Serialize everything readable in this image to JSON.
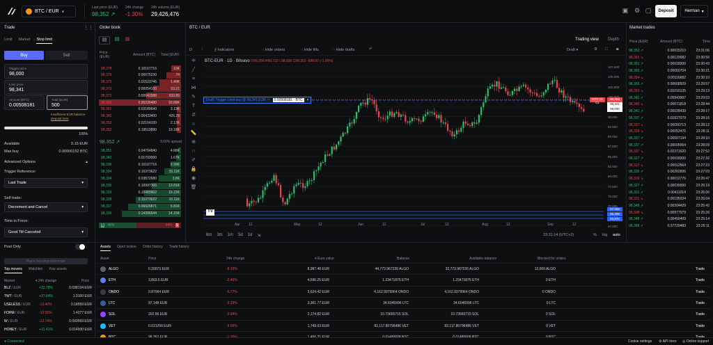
{
  "header": {
    "pair": "BTC / EUR",
    "last_price_label": "Last price (EUR)",
    "last_price": "98,352",
    "change_label": "24h change",
    "change": "-1.30%",
    "volume_label": "24h volume (EUR)",
    "volume": "29,426,476",
    "deposit": "Deposit",
    "user": "Herman"
  },
  "trade": {
    "title": "Trade",
    "tabs": [
      "Limit",
      "Market",
      "Stop limit"
    ],
    "buy": "Buy",
    "sell": "Sell",
    "trigger_label": "Trigger price",
    "trigger_value": "98,000",
    "limit_label": "Limit price",
    "limit_value": "98,341",
    "amount_label": "Amount (BTC)",
    "amount_value": "0.00508181",
    "total_label": "Total (EUR)",
    "total_value": "500",
    "warning": "Insufficient EUR balance.",
    "warning_link": "Deposit here",
    "slider_pct": "100%",
    "available_label": "Available",
    "available_value": "0.15 EUR",
    "maxbuy_label": "Max buy",
    "maxbuy_value": "0.00000152 BTC",
    "advanced": "Advanced Options",
    "trigger_ref_label": "Trigger Reference:",
    "trigger_ref": "Last Trade",
    "self_trade_label": "Self trade:",
    "self_trade": "Decrement and Cancel",
    "tif_label": "Time in Force:",
    "tif": "Good Till Canceled",
    "post_only": "Post Only",
    "submit": "Place buy stop limit order"
  },
  "movers": {
    "tabs": [
      "Top movers",
      "Watchlist",
      "Your assets"
    ],
    "col_market": "Market",
    "col_change": "24h change",
    "col_price": "Price",
    "rows": [
      {
        "m": "BLZ",
        "q": "/ EUR",
        "c": "+32.78%",
        "p": "0.038134 EUR",
        "up": true
      },
      {
        "m": "TWT",
        "q": "/ EUR",
        "c": "+27.64%",
        "p": "1.0100 EUR",
        "up": true
      },
      {
        "m": "USELESS",
        "q": "/ EUR",
        "c": "-13.40%",
        "p": "0.18559 EUR",
        "up": false
      },
      {
        "m": "FORM",
        "q": "/ EUR",
        "c": "-12.95%",
        "p": "1.4377 EUR",
        "up": false
      },
      {
        "m": "W",
        "q": "/ EUR",
        "c": "-12.74%",
        "p": "0.093569 EUR",
        "up": false
      },
      {
        "m": "HONEY",
        "q": "/ EUR",
        "c": "+12.41%",
        "p": "0.014500 EUR",
        "up": true
      }
    ]
  },
  "orderbook": {
    "title": "Order book",
    "col_price": "Price (EUR)",
    "col_amount": "Amount (BTC)",
    "col_total": "Total (EUR)",
    "spread_price": "98,352",
    "spread_label": "0.00% spread",
    "asks": [
      [
        "98,378",
        "0.10167716",
        "10K",
        0.12
      ],
      [
        "98,376",
        "0.00075230",
        "74",
        0.18
      ],
      [
        "98,375",
        "0.01523746",
        "1.49K",
        0.26
      ],
      [
        "98,373",
        "0.00054100",
        "53.21",
        0.34
      ],
      [
        "98,372",
        "0.00643388",
        "633.89",
        0.42
      ],
      [
        "98,369",
        "0.95239480",
        "93.68K",
        1.0
      ],
      [
        "98,361",
        "0.03189640",
        "3.13K",
        0.05
      ],
      [
        "98,360",
        "0.00433400",
        "426.29",
        0.05
      ],
      [
        "98,353",
        "0.02164100",
        "2.13K",
        0.05
      ],
      [
        "98,352",
        "0.19510890",
        "19.18K",
        0.05
      ]
    ],
    "bids": [
      [
        "98,351",
        "0.04764840",
        "4.68K",
        0.03
      ],
      [
        "98,342",
        "0.01700000",
        "1.67K",
        0.06
      ],
      [
        "98,336",
        "0.10167716",
        "9.99K",
        0.13
      ],
      [
        "98,334",
        "0.15373622",
        "15.11K",
        0.2
      ],
      [
        "98,334",
        "0.03872680",
        "3.8K",
        0.27
      ],
      [
        "98,330",
        "0.10997366",
        "10.81K",
        0.36
      ],
      [
        "98,329",
        "0.15483902",
        "15.22K",
        0.45
      ],
      [
        "98,328",
        "0.15373622",
        "15.11K",
        0.55
      ],
      [
        "98,327",
        "0.06926871",
        "6.81K",
        0.64
      ],
      [
        "98,326",
        "0.14396544",
        "14.15K",
        0.72
      ]
    ],
    "ratio_b": "B",
    "ratio_b_pct": "46%",
    "ratio_s_pct": "54%",
    "ratio_s": "S"
  },
  "chart": {
    "tab": "BTC / EUR",
    "trading_view": "Trading view",
    "depth": "Depth",
    "interval": "D",
    "indicators": "Indicators",
    "hide_orders": "Hide orders",
    "hide_fills": "Hide fills",
    "hide_drafts": "Hide drafts",
    "draft": "Draft",
    "save": "Save",
    "legend": "BTC-EUR · 1D · Bitvavo",
    "ohlc": "O99,356 H99,732 L98,036 C98,352 -998.00 (-1.00%)",
    "draft_order": "Draft: Trigger Limit buy @ 98,341 EUR ->",
    "draft_amt": "0.00508181 · BTC",
    "price_ticks": [
      "107,500",
      "105,000",
      "102,500",
      "100,000",
      "97,500",
      "95,000",
      "92,500",
      "90,000",
      "87,500",
      "85,000",
      "82,500",
      "80,000",
      "77,500",
      "75,000",
      "72,500",
      "70,000",
      "67,500"
    ],
    "tag_trig": "98,352",
    "tag_last": "98,341",
    "tag_set": "98,000",
    "tag_l1": "67,069",
    "tag_l2": "66,395",
    "tag_l3": "63,970",
    "tag_red": "OTC 11 G1",
    "months": [
      "Apr",
      "12",
      "May",
      "12",
      "Jun",
      "12",
      "Jul",
      "12",
      "Aug",
      "12",
      "Sep",
      "12"
    ],
    "ranges": [
      "6m",
      "3m",
      "1m",
      "5d",
      "1d"
    ],
    "clock": "23:31:14 (UTC+2)",
    "pct": "%",
    "log": "log",
    "auto": "auto"
  },
  "market_trades": {
    "title": "Market trades",
    "col_price": "Price (EUR)",
    "col_amount": "Amount (BTC)",
    "col_time": "Time",
    "rows": [
      [
        "98,352",
        "0.00015210",
        "23:31:06",
        1
      ],
      [
        "98,351",
        "0.00120082",
        "23:30:56",
        0
      ],
      [
        "98,351",
        "0.00018300",
        "23:30:43",
        1
      ],
      [
        "98,355",
        "0.00050704",
        "23:30:21",
        1
      ],
      [
        "98,354",
        "0.00116682",
        "23:30:10",
        0
      ],
      [
        "98,355",
        "0.00608509",
        "23:29:57",
        1
      ],
      [
        "98,353",
        "0.01016135",
        "23:29:13",
        0
      ],
      [
        "98,341",
        "0.05943007",
        "23:29:03",
        1
      ],
      [
        "98,340",
        "0.00671818",
        "23:28:44",
        0
      ],
      [
        "98,341",
        "0.00028439",
        "23:28:17",
        1
      ],
      [
        "98,337",
        "0.01827079",
        "23:28:16",
        1
      ],
      [
        "98,337",
        "0.00050713",
        "23:28:12",
        0
      ],
      [
        "98,329",
        "0.00052476",
        "23:28:11",
        0
      ],
      [
        "98,337",
        "0.00507194",
        "23:28:10",
        1
      ],
      [
        "98,337",
        "0.00005064",
        "23:28:09",
        1
      ],
      [
        "98,327",
        "0.02371620",
        "23:27:52",
        0
      ],
      [
        "98,327",
        "0.00018300",
        "23:27:32",
        1
      ],
      [
        "98,317",
        "0.00012564",
        "23:27:23",
        0
      ],
      [
        "98,326",
        "0.00202896",
        "23:27:03",
        1
      ],
      [
        "98,319",
        "0.00012776",
        "23:26:47",
        0
      ],
      [
        "98,327",
        "0.00030000",
        "23:26:19",
        1
      ],
      [
        "98,321",
        "0.00411014",
        "23:26:06",
        1
      ],
      [
        "98,321",
        "0.00195334",
        "23:26:04",
        0
      ],
      [
        "98,348",
        "0.00304429",
        "23:25:42",
        1
      ],
      [
        "98,338",
        "0.00977979",
        "23:25:26",
        0
      ],
      [
        "98,348",
        "0.00456409",
        "23:25:14",
        1
      ],
      [
        "98,368",
        "0.37729483",
        "23:25:11",
        1
      ]
    ]
  },
  "assets": {
    "tabs": [
      "Assets",
      "Open orders",
      "Order history",
      "Trade history"
    ],
    "cols": [
      "Asset",
      "Price",
      "24h change",
      "Euro value",
      "Balance",
      "Available balance",
      "Blocked for orders"
    ],
    "trade": "Trade",
    "rows": [
      {
        "sym": "ALGO",
        "price": "0.20073 EUR",
        "chg": "-8.16%",
        "eur": "8,987.48 EUR",
        "bal": "44,773.967235 ALGO",
        "avail": "32,773.967235 ALGO",
        "blk": "12,000 ALGO",
        "c": "#5a5f6a"
      },
      {
        "sym": "ETH",
        "price": "3,803.5 EUR",
        "chg": "-2.46%",
        "eur": "4,696.25 EUR",
        "bal": "1.23471875 ETH",
        "avail": "1.23471875 ETH",
        "blk": "0 ETH",
        "c": "#627eea"
      },
      {
        "sym": "ONDO",
        "price": "0.87064 EUR",
        "chg": "-5.77%",
        "eur": "3,624.42 EUR",
        "bal": "4,162.9379964 ONDO",
        "avail": "4,162.9379964 ONDO",
        "blk": "0 ONDO",
        "c": "#3a3d44"
      },
      {
        "sym": "LTC",
        "price": "97.148 EUR",
        "chg": "-3.19%",
        "eur": "3,361.77 EUR",
        "bal": "34.6045996 LTC",
        "avail": "34.6045996 LTC",
        "blk": "0 LTC",
        "c": "#345d9d"
      },
      {
        "sym": "SOL",
        "price": "202.56 EUR",
        "chg": "-3.84%",
        "eur": "2,174.82 EUR",
        "bal": "10.73665715 SOL",
        "avail": "10.73665715 SOL",
        "blk": "0 SOL",
        "c": "#9945ff"
      },
      {
        "sym": "VET",
        "price": "0.021299 EUR",
        "chg": "-3.66%",
        "eur": "1,749.03 EUR",
        "bal": "82,117.80796486 VET",
        "avail": "82,117.80796486 VET",
        "blk": "0 VET",
        "c": "#15bdff"
      },
      {
        "sym": "BTC",
        "price": "98,352 EUR",
        "chg": "-1.30%",
        "eur": "1,456.21 EUR",
        "bal": "0.01480608 BTC",
        "avail": "0.01480608 BTC",
        "blk": "0 BTC",
        "c": "#f7931a"
      }
    ]
  },
  "footer": {
    "status": "Connected",
    "cookie": "Cookie settings",
    "api": "API docs",
    "support": "Online support"
  }
}
